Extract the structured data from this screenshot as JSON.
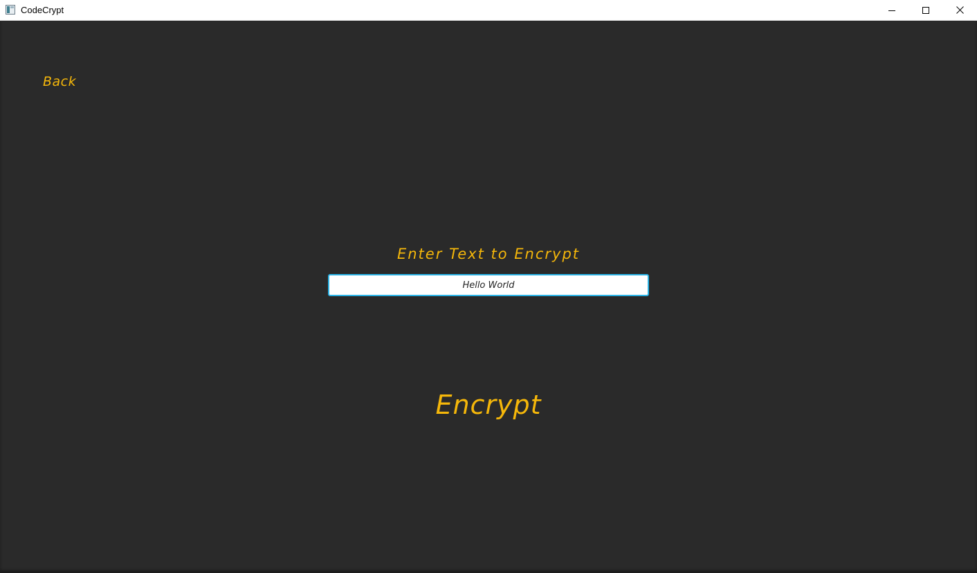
{
  "window": {
    "title": "CodeCrypt",
    "controls": {
      "minimize_icon": "minimize-icon",
      "maximize_icon": "maximize-icon",
      "close_icon": "close-icon"
    }
  },
  "nav": {
    "back_label": "Back"
  },
  "form": {
    "prompt_label": "Enter Text to Encrypt",
    "input_value": "Hello World"
  },
  "actions": {
    "encrypt_label": "Encrypt"
  },
  "colors": {
    "background": "#2a2a2a",
    "accent": "#f5b70a",
    "input_border": "#2bb3e6"
  }
}
